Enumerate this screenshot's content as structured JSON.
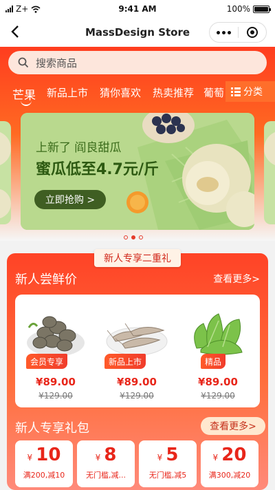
{
  "status_bar": {
    "carrier": "Z+",
    "time": "9:41 AM",
    "battery": "100%"
  },
  "nav": {
    "title": "MassDesign Store"
  },
  "search": {
    "placeholder": "搜索商品"
  },
  "categories": {
    "items": [
      "芒果",
      "新品上市",
      "猜你喜欢",
      "热卖推荐",
      "葡萄"
    ],
    "active_index": 0,
    "menu_label": "分类"
  },
  "banner": {
    "subtitle": "上新了 阎良甜瓜",
    "headline": "蜜瓜低至4.7元/斤",
    "button": "立即抢购 >",
    "page_count": 3,
    "active_page": 2
  },
  "promo": {
    "ribbon": "新人专享二重礼",
    "section1_title": "新人尝鲜价",
    "section1_more": "查看更多>",
    "products": [
      {
        "image": "clams-icon",
        "tag": "会员专享",
        "price": "¥89.00",
        "original_price": "¥129.00"
      },
      {
        "image": "shrimp-icon",
        "tag": "新品上市",
        "price": "¥89.00",
        "original_price": "¥129.00"
      },
      {
        "image": "lettuce-icon",
        "tag": "精品",
        "price": "¥89.00",
        "original_price": "¥129.00"
      }
    ],
    "section2_title": "新人专享礼包",
    "section2_more": "查看更多>",
    "coupons": [
      {
        "currency": "¥",
        "amount": "10",
        "condition": "满200,减10"
      },
      {
        "currency": "¥",
        "amount": "8",
        "condition": "无门槛,减..."
      },
      {
        "currency": "¥",
        "amount": "5",
        "condition": "无门槛,减5"
      },
      {
        "currency": "¥",
        "amount": "20",
        "condition": "满300,减20"
      }
    ]
  },
  "colors": {
    "brand_red": "#ff3d1f",
    "price_red": "#e8261a",
    "banner_green": "#b9d98e"
  }
}
